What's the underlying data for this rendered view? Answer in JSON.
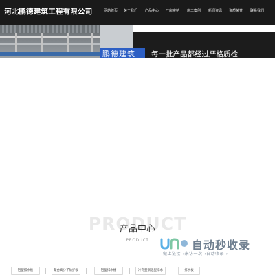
{
  "header": {
    "company_name": "河北鹏德建筑工程有限公司",
    "nav": [
      "网站首页",
      "关于我们",
      "产品中心",
      "厂房实拍",
      "施工案例",
      "新闻资讯",
      "资质荣誉",
      "联系我们"
    ]
  },
  "hero": {
    "badge_text": "鹏德建筑",
    "caption": "每一批产品都经过严格质检"
  },
  "products_section": {
    "watermark": "PRODUCT",
    "title": "产品中心",
    "subtitle": "PRODUCT",
    "tabs": [
      "铝型排水板",
      "聚合高分子防护板",
      "铝型排水槽",
      "冷弯型钢铝型排水",
      "排水板"
    ]
  },
  "watermark_logo": {
    "text": "自动秒收录",
    "slogan": "做上链接→来访一次→自动收录→"
  },
  "colors": {
    "header_bg": "#1a1a1a",
    "badge_blue": "#2d5fc4",
    "watermark_gray": "#6f7f90"
  }
}
